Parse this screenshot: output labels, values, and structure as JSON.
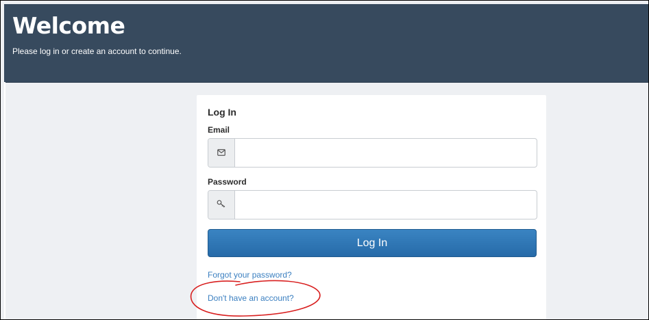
{
  "header": {
    "title": "Welcome",
    "subtitle": "Please log in or create an account to continue."
  },
  "login_card": {
    "title": "Log In",
    "email": {
      "label": "Email",
      "value": "",
      "placeholder": "",
      "icon": "envelope-icon"
    },
    "password": {
      "label": "Password",
      "value": "",
      "placeholder": "",
      "icon": "key-icon"
    },
    "submit_label": "Log In",
    "forgot_link": "Forgot your password?",
    "signup_link": "Don't have an account?"
  },
  "colors": {
    "header_bg": "#374a5e",
    "button_bg": "#2f77b6",
    "link": "#3a7fc0",
    "annotation": "#d81e1e"
  }
}
